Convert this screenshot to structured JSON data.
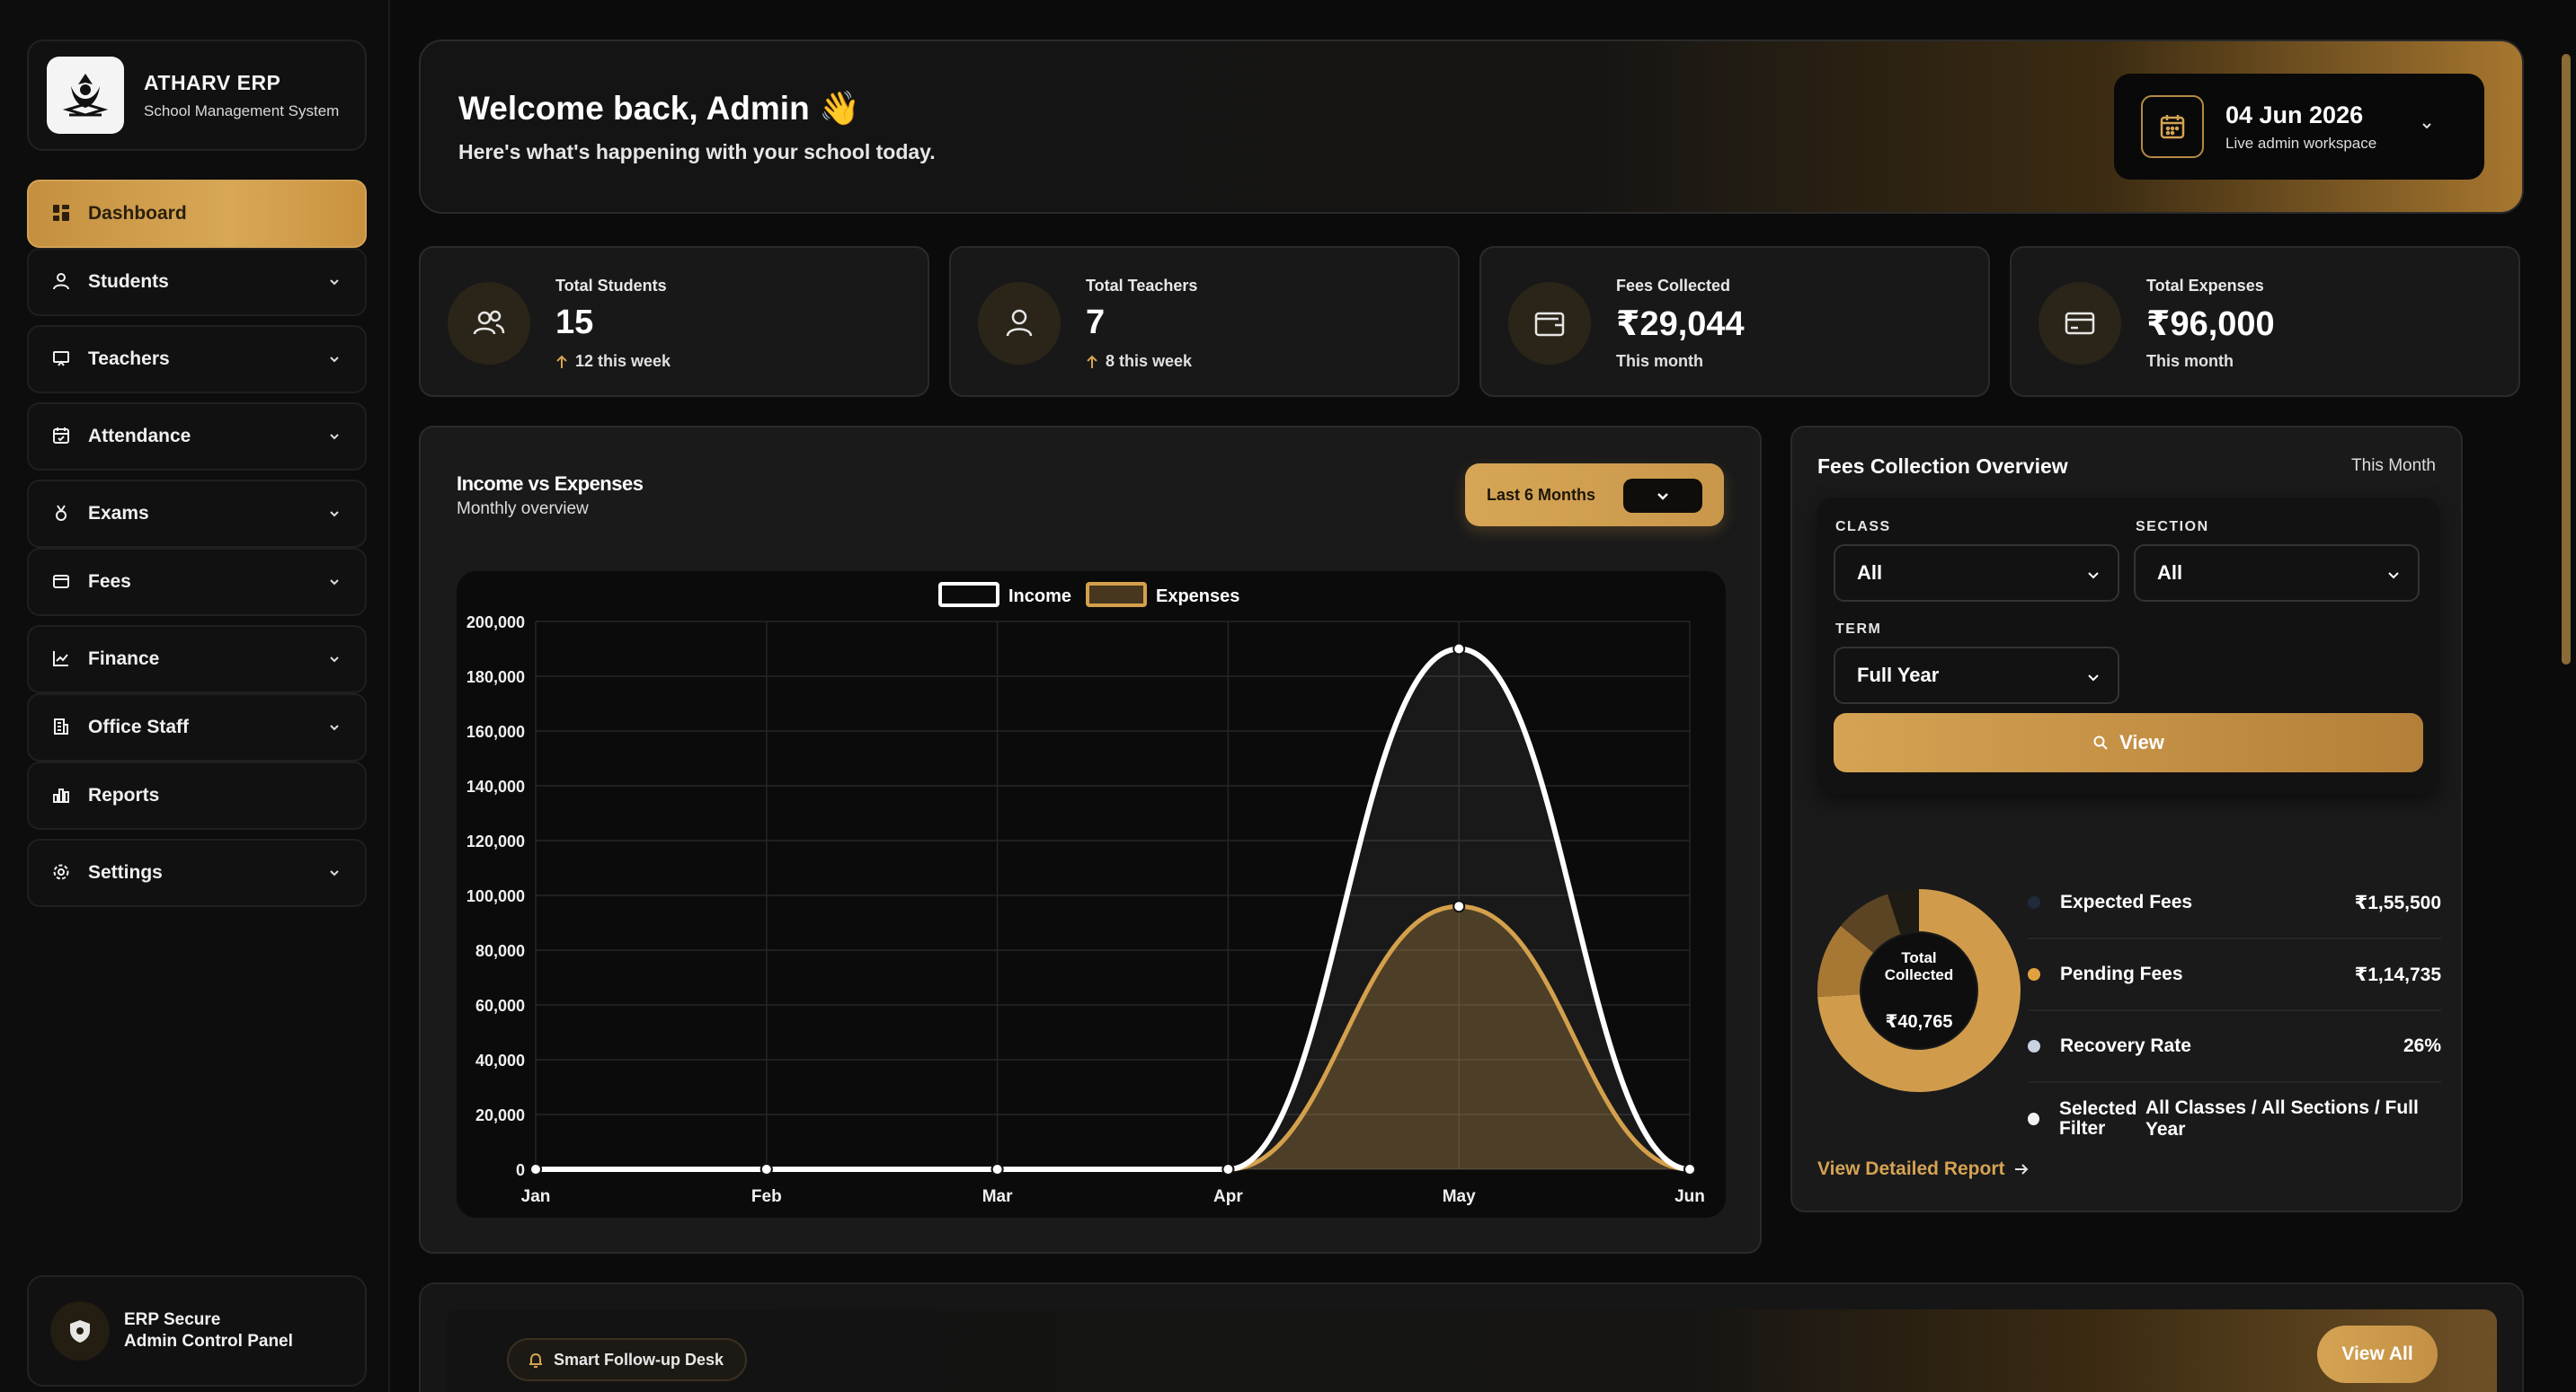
{
  "brand": {
    "title": "ATHARV ERP",
    "subtitle": "School Management System"
  },
  "sidebar": {
    "items": [
      {
        "label": "Dashboard",
        "icon": "grid-icon",
        "active": true
      },
      {
        "label": "Students",
        "icon": "user-icon",
        "expandable": true
      },
      {
        "label": "Teachers",
        "icon": "presentation-icon",
        "expandable": true
      },
      {
        "label": "Attendance",
        "icon": "calendar-check-icon",
        "expandable": true
      },
      {
        "label": "Exams",
        "icon": "medal-icon",
        "expandable": true
      },
      {
        "label": "Fees",
        "icon": "wallet-icon",
        "expandable": true
      },
      {
        "label": "Finance",
        "icon": "chart-line-icon",
        "expandable": true
      },
      {
        "label": "Office Staff",
        "icon": "building-icon",
        "expandable": true
      },
      {
        "label": "Reports",
        "icon": "bar-chart-icon",
        "expandable": false
      },
      {
        "label": "Settings",
        "icon": "gear-icon",
        "expandable": true
      }
    ],
    "secure": {
      "line1": "ERP Secure",
      "line2": "Admin Control Panel"
    }
  },
  "header": {
    "welcome": "Welcome back, Admin 👋",
    "subtitle": "Here's what's happening with your school today.",
    "date": "04 Jun 2026",
    "date_sub": "Live admin workspace"
  },
  "stats": [
    {
      "label": "Total Students",
      "value": "15",
      "note": "12 this week",
      "arrow": true
    },
    {
      "label": "Total Teachers",
      "value": "7",
      "note": "8 this week",
      "arrow": true
    },
    {
      "label": "Fees Collected",
      "value": "₹29,044",
      "note": "This month",
      "arrow": false
    },
    {
      "label": "Total Expenses",
      "value": "₹96,000",
      "note": "This month",
      "arrow": false
    }
  ],
  "income_panel": {
    "title": "Income vs Expenses",
    "subtitle": "Monthly overview",
    "range_label": "Last 6 Months"
  },
  "chart_data": {
    "type": "line",
    "categories": [
      "Jan",
      "Feb",
      "Mar",
      "Apr",
      "May",
      "Jun"
    ],
    "series": [
      {
        "name": "Income",
        "values": [
          0,
          0,
          0,
          0,
          190000,
          0
        ],
        "color": "#ffffff"
      },
      {
        "name": "Expenses",
        "values": [
          0,
          0,
          0,
          0,
          96000,
          0
        ],
        "color": "#d4a04c"
      }
    ],
    "ylim": [
      0,
      200000
    ],
    "yticks": [
      0,
      20000,
      40000,
      60000,
      80000,
      100000,
      120000,
      140000,
      160000,
      180000,
      200000
    ],
    "ytick_labels": [
      "0",
      "20,000",
      "40,000",
      "60,000",
      "80,000",
      "100,000",
      "120,000",
      "140,000",
      "160,000",
      "180,000",
      "200,000"
    ],
    "grid": true,
    "legend": "top-center"
  },
  "fees_panel": {
    "title": "Fees Collection Overview",
    "period": "This Month",
    "class_label": "CLASS",
    "class_value": "All",
    "section_label": "SECTION",
    "section_value": "All",
    "term_label": "TERM",
    "term_value": "Full Year",
    "view_label": "View",
    "donut": {
      "center_label": "Total Collected",
      "center_value": "₹40,765",
      "slices": [
        {
          "value": 74,
          "color": "#d09c4c"
        },
        {
          "value": 12,
          "color": "#a77834"
        },
        {
          "value": 9,
          "color": "#5a4424"
        },
        {
          "value": 5,
          "color": "#1e1a14"
        }
      ]
    },
    "legend": [
      {
        "label": "Expected Fees",
        "value": "₹1,55,500",
        "color": "#1f2a3a"
      },
      {
        "label": "Pending Fees",
        "value": "₹1,14,735",
        "color": "#e0a23e"
      },
      {
        "label": "Recovery Rate",
        "value": "26%",
        "color": "#c9d2e0"
      },
      {
        "label": "Selected Filter",
        "value": "All Classes / All Sections / Full Year",
        "color": "#f2f2f2"
      }
    ],
    "report_link": "View Detailed Report"
  },
  "followup": {
    "label": "Smart Follow-up Desk",
    "view_all": "View All"
  }
}
